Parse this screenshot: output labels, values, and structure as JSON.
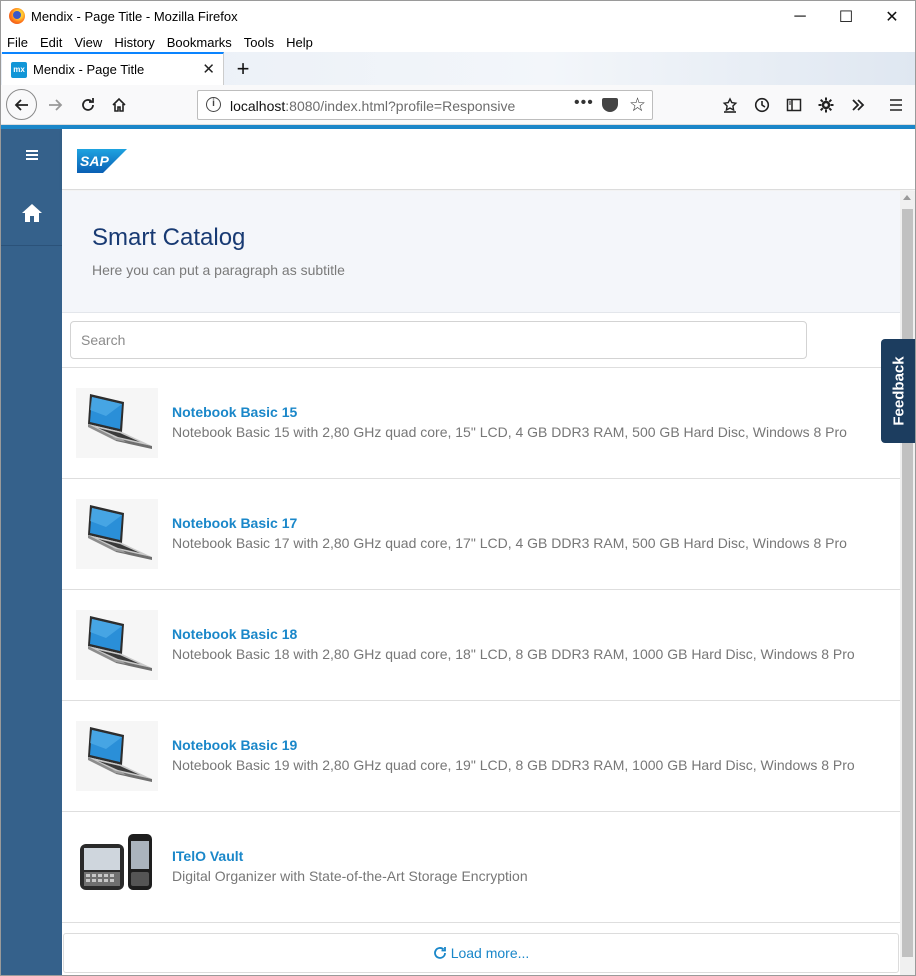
{
  "window": {
    "title": "Mendix - Page Title - Mozilla Firefox",
    "minimize": "─",
    "maximize": "☐",
    "close": "✕"
  },
  "menu": [
    "File",
    "Edit",
    "View",
    "History",
    "Bookmarks",
    "Tools",
    "Help"
  ],
  "tab": {
    "favicon_text": "mx",
    "title": "Mendix - Page Title",
    "close": "✕",
    "new_tab": "+"
  },
  "nav": {
    "url_host": "localhost",
    "url_rest": ":8080/index.html?profile=Responsive",
    "page_actions": "•••",
    "star": "☆"
  },
  "app": {
    "logo_text": "SAP",
    "logo_color": "#0a6ed1",
    "sidebar_color": "#35618b",
    "accent_color": "#1b87c9",
    "title": "Smart Catalog",
    "subtitle": "Here you can put a paragraph as subtitle",
    "search_placeholder": "Search",
    "load_more": "Load more...",
    "feedback": "Feedback"
  },
  "products": [
    {
      "name": "Notebook Basic 15",
      "description": "Notebook Basic 15 with 2,80 GHz quad core, 15\" LCD, 4 GB DDR3 RAM, 500 GB Hard Disc, Windows 8 Pro",
      "image": "laptop"
    },
    {
      "name": "Notebook Basic 17",
      "description": "Notebook Basic 17 with 2,80 GHz quad core, 17\" LCD, 4 GB DDR3 RAM, 500 GB Hard Disc, Windows 8 Pro",
      "image": "laptop"
    },
    {
      "name": "Notebook Basic 18",
      "description": "Notebook Basic 18 with 2,80 GHz quad core, 18\" LCD, 8 GB DDR3 RAM, 1000 GB Hard Disc, Windows 8 Pro",
      "image": "laptop"
    },
    {
      "name": "Notebook Basic 19",
      "description": "Notebook Basic 19 with 2,80 GHz quad core, 19\" LCD, 8 GB DDR3 RAM, 1000 GB Hard Disc, Windows 8 Pro",
      "image": "laptop"
    },
    {
      "name": "ITelO Vault",
      "description": "Digital Organizer with State-of-the-Art Storage Encryption",
      "image": "pda"
    }
  ]
}
